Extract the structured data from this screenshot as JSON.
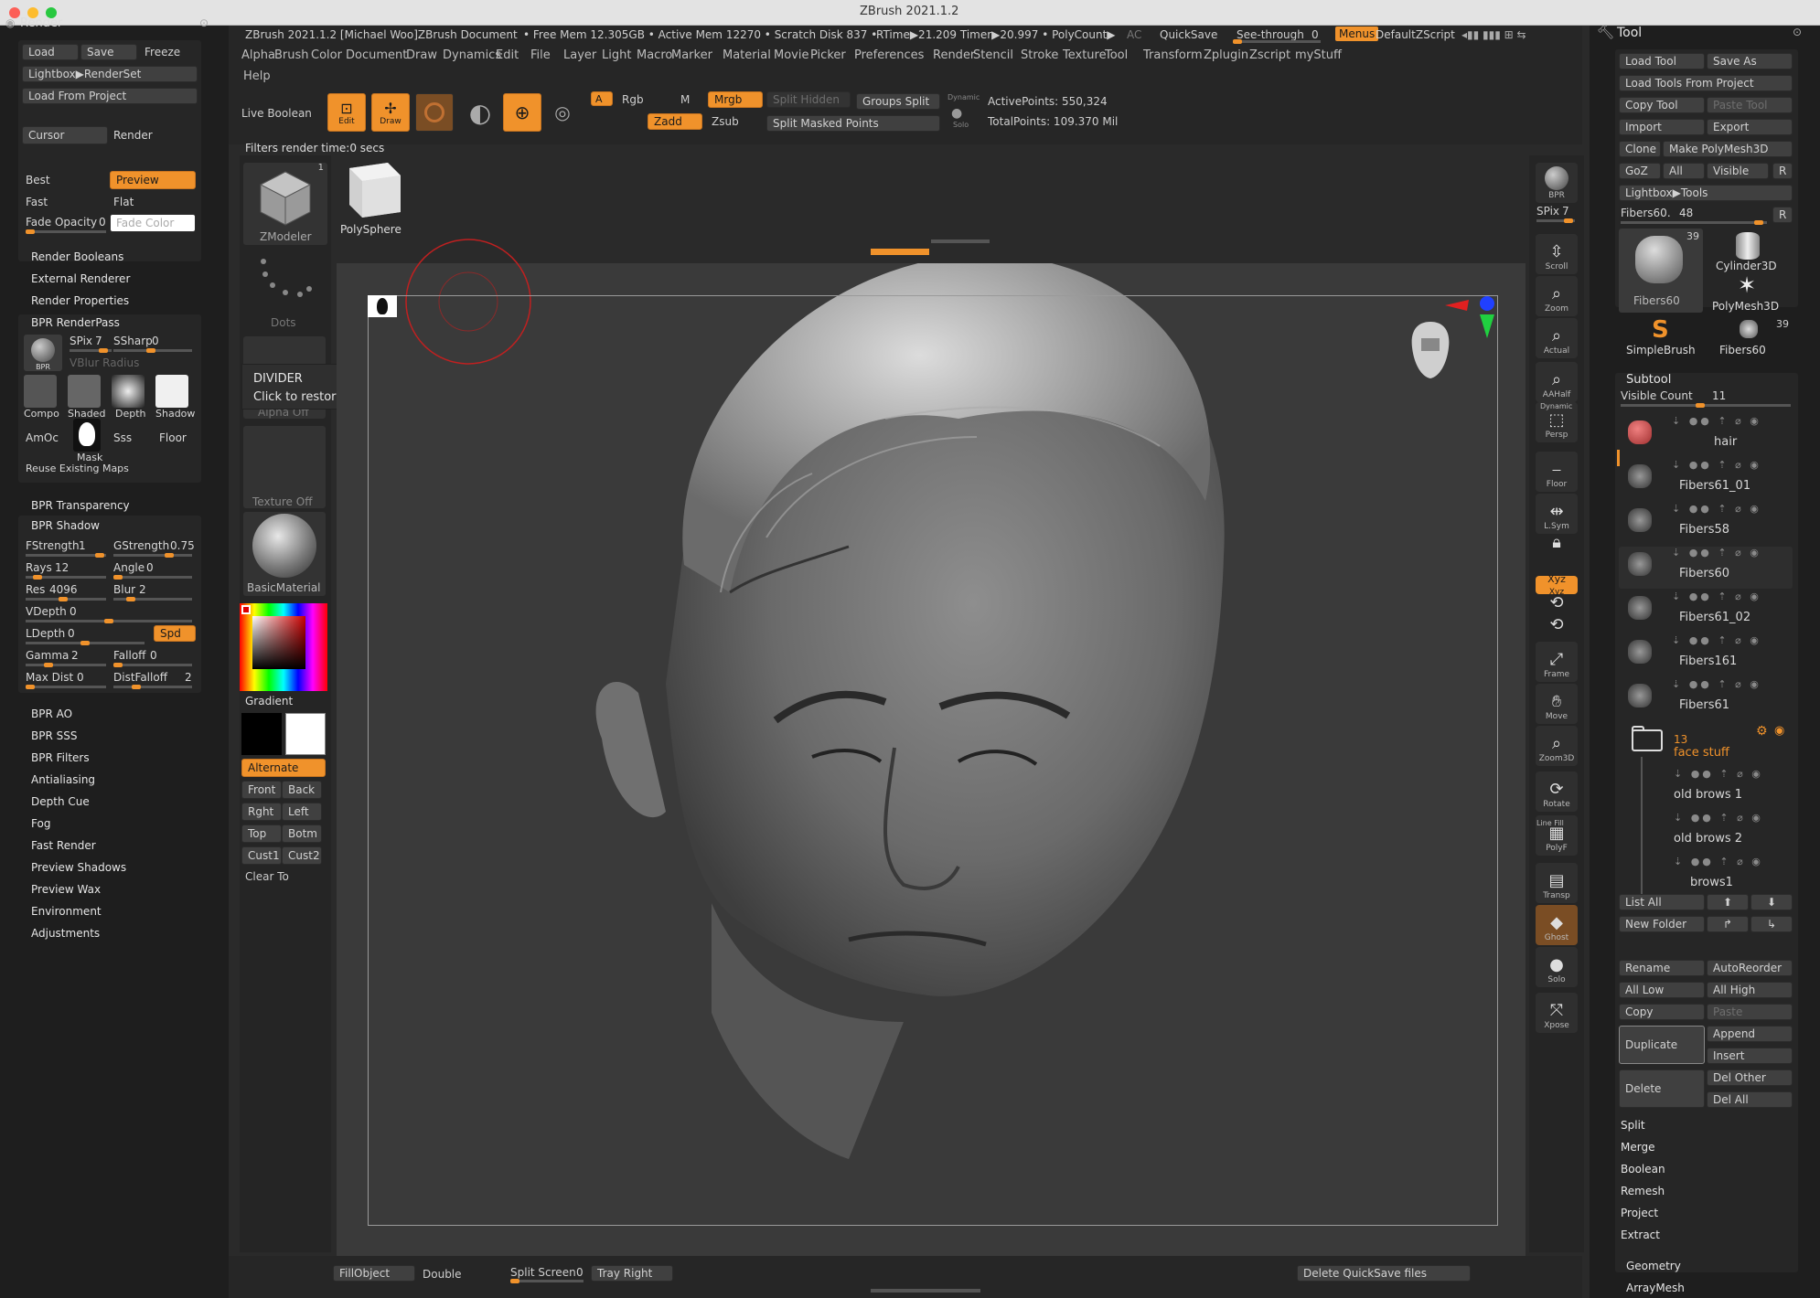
{
  "app": {
    "title": "ZBrush 2021.1.2"
  },
  "status": {
    "doc": "ZBrush 2021.1.2 [Michael Woo]ZBrush Document",
    "mem": "• Free Mem 12.305GB • Active Mem 12270 • Scratch Disk 837 •",
    "rtime": "RTime▶21.209 Timer▶20.997 • PolyCount▶",
    "ac": "AC",
    "quicksave": "QuickSave",
    "seethrough": "See-through",
    "seethrough_val": "0",
    "menus": "Menus",
    "zscript": "DefaultZScript"
  },
  "menu": {
    "row1": [
      "Alpha",
      "Brush",
      "Color",
      "Document",
      "Draw",
      "Dynamics",
      "Edit",
      "File",
      "Layer",
      "Light",
      "Macro",
      "Marker",
      "Material",
      "Movie",
      "Picker",
      "Preferences",
      "Render",
      "Stencil",
      "Stroke",
      "Texture",
      "Tool",
      "Transform",
      "Zplugin",
      "Zscript",
      "myStuff"
    ],
    "help": "Help"
  },
  "toolbar": {
    "live_boolean": "Live Boolean",
    "edit": "Edit",
    "draw": "Draw",
    "a": "A",
    "rgb": "Rgb",
    "m": "M",
    "mrgb": "Mrgb",
    "zadd": "Zadd",
    "zsub": "Zsub",
    "split_hidden": "Split Hidden",
    "groups_split": "Groups Split",
    "split_masked": "Split Masked Points",
    "dynamic": "Dynamic",
    "solo": "Solo",
    "active_points": "ActivePoints: 550,324",
    "total_points": "TotalPoints: 109.370 Mil",
    "filters_time": "Filters render time:0 secs"
  },
  "render_panel": {
    "title": "Render",
    "load": "Load",
    "save": "Save",
    "freeze": "Freeze",
    "lightbox": "Lightbox▶RenderSet",
    "load_from_project": "Load From Project",
    "cursor": "Cursor",
    "render": "Render",
    "best": "Best",
    "preview": "Preview",
    "fast": "Fast",
    "flat": "Flat",
    "fade_opacity": "Fade Opacity",
    "fade_opacity_val": "0",
    "fade_color": "Fade Color",
    "render_booleans": "Render Booleans",
    "external_renderer": "External Renderer",
    "render_properties": "Render Properties",
    "bpr_renderpass": "BPR RenderPass",
    "spix": "SPix",
    "spix_val": "7",
    "ssharp": "SSharp",
    "ssharp_val": "0",
    "vblur": "VBlur Radius",
    "passes": [
      "Compo",
      "Shaded",
      "Depth",
      "Shadow"
    ],
    "amoc": "AmOc",
    "mask": "Mask",
    "sss": "Sss",
    "floor": "Floor",
    "reuse": "Reuse Existing Maps",
    "bpr_transparency": "BPR Transparency",
    "bpr_shadow": "BPR Shadow",
    "fstrength": "FStrength",
    "fstrength_val": "1",
    "gstrength": "GStrength",
    "gstrength_val": "0.75",
    "rays": "Rays",
    "rays_val": "12",
    "angle": "Angle",
    "angle_val": "0",
    "res": "Res",
    "res_val": "4096",
    "blur": "Blur",
    "blur_val": "2",
    "vdepth": "VDepth",
    "vdepth_val": "0",
    "ldepth": "LDepth",
    "ldepth_val": "0",
    "spd": "Spd",
    "gamma": "Gamma",
    "gamma_val": "2",
    "falloff": "Falloff",
    "falloff_val": "0",
    "maxdist": "Max Dist",
    "maxdist_val": "0",
    "distfalloff": "DistFalloff",
    "distfalloff_val": "2",
    "subs": [
      "BPR AO",
      "BPR SSS",
      "BPR Filters",
      "Antialiasing",
      "Depth Cue",
      "Fog",
      "Fast Render",
      "Preview Shadows",
      "Preview Wax",
      "Environment",
      "Adjustments"
    ]
  },
  "left_shelf": {
    "zmodeler": "ZModeler",
    "zmodeler_count": "1",
    "polysphere": "PolySphere",
    "dots": "Dots",
    "alpha_off": "Alpha Off",
    "texture_off": "Texture Off",
    "basic_material": "BasicMaterial",
    "gradient": "Gradient",
    "alternate": "Alternate",
    "front": "Front",
    "back": "Back",
    "rght": "Rght",
    "left": "Left",
    "top": "Top",
    "botm": "Botm",
    "cust1": "Cust1",
    "cust2": "Cust2",
    "clear_to": "Clear To"
  },
  "tooltip": {
    "title": "DIVIDER",
    "text": "Click to restore previous position."
  },
  "right_shelf": {
    "bpr": "BPR",
    "spix": "SPix",
    "spix_val": "7",
    "items": [
      "Scroll",
      "Zoom",
      "Actual",
      "AAHalf",
      "Persp",
      "Floor",
      "L.Sym",
      "",
      "Xyz",
      "",
      "",
      "Frame",
      "Move",
      "Zoom3D",
      "Rotate",
      "PolyF",
      "Transp",
      "Ghost",
      "Solo",
      "Xpose"
    ],
    "dynamic": "Dynamic",
    "line_fill": "Line Fill"
  },
  "tool_panel": {
    "title": "Tool",
    "load_tool": "Load Tool",
    "save_as": "Save As",
    "load_tools_project": "Load Tools From Project",
    "copy_tool": "Copy Tool",
    "paste_tool": "Paste Tool",
    "import": "Import",
    "export": "Export",
    "clone": "Clone",
    "make_polymesh": "Make PolyMesh3D",
    "goz": "GoZ",
    "all": "All",
    "visible": "Visible",
    "r": "R",
    "lightbox_tools": "Lightbox▶Tools",
    "fibers_label": "Fibers60.",
    "fibers_val": "48",
    "thumbs": [
      {
        "name": "Fibers60",
        "count": "39"
      },
      {
        "name": "Cylinder3D",
        "count": ""
      },
      {
        "name": "PolyMesh3D",
        "count": ""
      },
      {
        "name": "SimpleBrush",
        "count": ""
      },
      {
        "name": "Fibers60",
        "count": "39"
      }
    ],
    "subtool": "Subtool",
    "visible_count": "Visible Count",
    "visible_count_val": "11",
    "subtools": [
      "hair",
      "Fibers61_01",
      "Fibers58",
      "Fibers60",
      "Fibers61_02",
      "Fibers161",
      "Fibers61"
    ],
    "folder_count": "13",
    "folder_name": "face stuff",
    "folder_items": [
      "old brows 1",
      "old brows 2",
      "brows1"
    ],
    "list_all": "List All",
    "new_folder": "New Folder",
    "rename": "Rename",
    "autoreorder": "AutoReorder",
    "all_low": "All Low",
    "all_high": "All High",
    "copy": "Copy",
    "paste": "Paste",
    "duplicate": "Duplicate",
    "append": "Append",
    "insert": "Insert",
    "delete": "Delete",
    "del_other": "Del Other",
    "del_all": "Del All",
    "subs": [
      "Split",
      "Merge",
      "Boolean",
      "Remesh",
      "Project",
      "Extract"
    ],
    "geometry": "Geometry",
    "arraymesh": "ArrayMesh"
  },
  "bottom": {
    "fillobject": "FillObject",
    "double": "Double",
    "split_screen": "Split Screen",
    "split_screen_val": "0",
    "tray_right": "Tray Right",
    "delete_quicksave": "Delete QuickSave files"
  },
  "colors": {
    "accent": "#f0922b",
    "panel": "#262626",
    "bg": "#1e1e1e"
  }
}
